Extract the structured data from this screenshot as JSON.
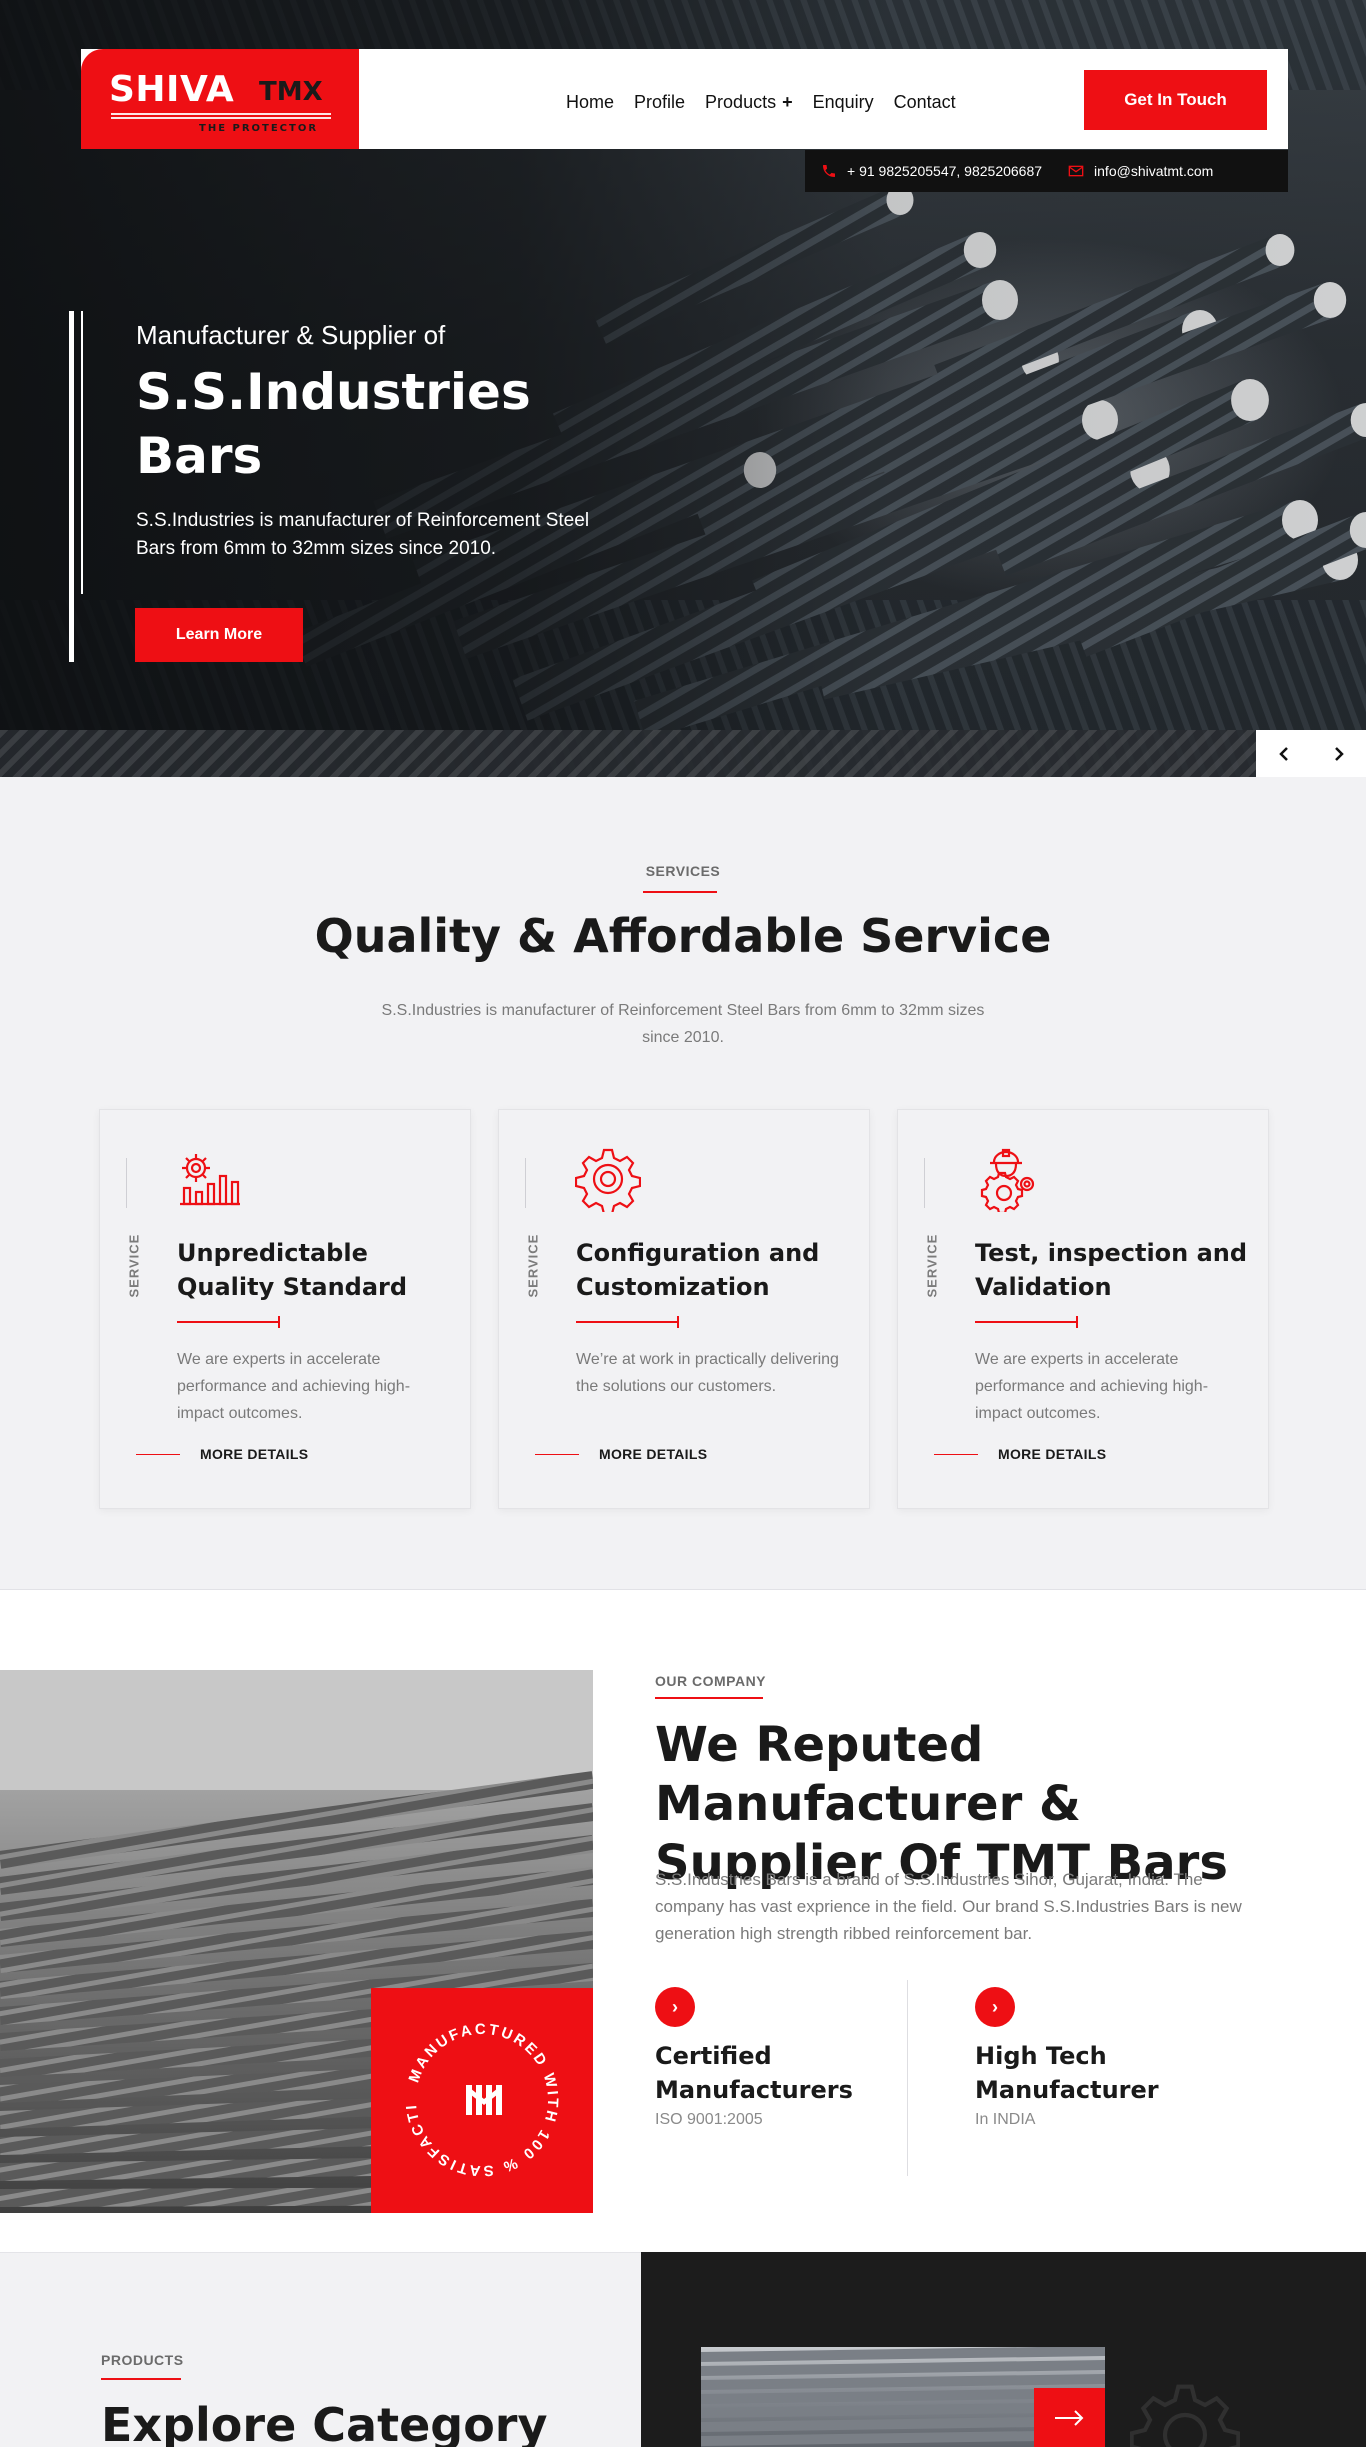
{
  "brand": {
    "name": "SHIVA",
    "suffix": "TMX",
    "tagline": "THE PROTECTOR"
  },
  "nav": {
    "items": [
      {
        "label": "Home"
      },
      {
        "label": "Profile"
      },
      {
        "label": "Products",
        "plus": "+"
      },
      {
        "label": "Enquiry"
      },
      {
        "label": "Contact"
      }
    ],
    "cta": "Get In Touch"
  },
  "contact": {
    "phone": "+ 91 9825205547, 9825206687",
    "email": "info@shivatmt.com"
  },
  "hero": {
    "kicker": "Manufacturer & Supplier of",
    "title": "S.S.Industries Bars",
    "description": "S.S.Industries is manufacturer of Reinforcement Steel Bars from 6mm to 32mm sizes since 2010.",
    "button": "Learn More",
    "prev": "‹",
    "next": "›"
  },
  "services": {
    "eyebrow": "SERVICES",
    "title": "Quality & Affordable Service",
    "description": "S.S.Industries is manufacturer of Reinforcement Steel Bars from 6mm to 32mm sizes since 2010.",
    "cards": [
      {
        "label": "SERVICE",
        "icon": "quality-chart-gear-icon",
        "title": "Unpredictable Quality Standard",
        "text": "We are experts in accelerate performance and achieving high-impact outcomes.",
        "more": "MORE DETAILS"
      },
      {
        "label": "SERVICE",
        "icon": "gear-icon",
        "title": "Configuration and Customization",
        "text": "We’re at work in practically delivering the solutions our customers.",
        "more": "MORE DETAILS"
      },
      {
        "label": "SERVICE",
        "icon": "engineer-gear-icon",
        "title": "Test, inspection and Validation",
        "text": "We are experts in accelerate performance and achieving high-impact outcomes.",
        "more": "MORE DETAILS"
      }
    ]
  },
  "company": {
    "eyebrow": "OUR COMPANY",
    "title": "We Reputed Manufacturer & Supplier Of TMT Bars",
    "description": "S.S.Industries Bars is a brand of S.S.Industries Sihor, Gujarat, India. The company has vast exprience in the field. Our brand S.S.Industries Bars is new generation high strength ribbed reinforcement bar.",
    "badge_text": "MANUFACTURED WITH 100 % SATISFACTION",
    "features": [
      {
        "title": "Certified Manufacturers",
        "sub": "ISO 9001:2005"
      },
      {
        "title": "High Tech Manufacturer",
        "sub": "In INDIA"
      }
    ]
  },
  "products": {
    "eyebrow": "PRODUCTS",
    "title": "Explore Category"
  },
  "colors": {
    "accent": "#ee0f14",
    "dark": "#1c1c1c",
    "light_bg": "#f2f2f4"
  }
}
